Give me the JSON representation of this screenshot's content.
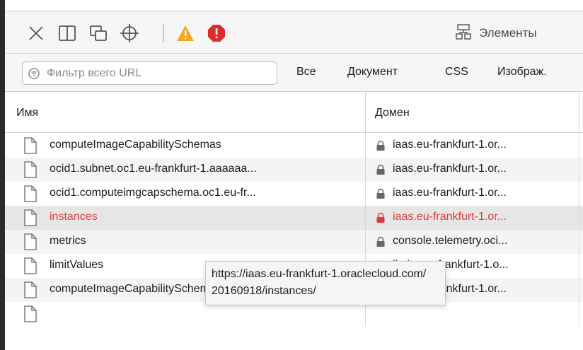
{
  "toolbar": {
    "icons": [
      "close-icon",
      "dock-split-icon",
      "undock-window-icon",
      "element-picker-icon",
      "warning-icon",
      "error-icon"
    ],
    "elements_tab_label": "Элементы"
  },
  "filter": {
    "placeholder": "Фильтр всего URL"
  },
  "type_filters": [
    "Все",
    "Документ",
    "CSS",
    "Изображ."
  ],
  "table": {
    "columns": [
      "Имя",
      "Домен"
    ],
    "rows": [
      {
        "name": "computeImageCapabilitySchemas",
        "domain": "iaas.eu-frankfurt-1.or...",
        "error": false
      },
      {
        "name": "ocid1.subnet.oc1.eu-frankfurt-1.aaaaaa...",
        "domain": "iaas.eu-frankfurt-1.or...",
        "error": false
      },
      {
        "name": "ocid1.computeimgcapschema.oc1.eu-fr...",
        "domain": "iaas.eu-frankfurt-1.or...",
        "error": false
      },
      {
        "name": "instances",
        "domain": "iaas.eu-frankfurt-1.or...",
        "error": true
      },
      {
        "name": "metrics",
        "domain": "console.telemetry.oci...",
        "error": false
      },
      {
        "name": "limitValues",
        "domain": "limits.eu-frankfurt-1.o...",
        "error": false
      },
      {
        "name": "computeImageCapabilitySchemas",
        "domain": "iaas.eu-frankfurt-1.or...",
        "error": false
      },
      {
        "name": "",
        "domain": "",
        "error": false
      }
    ]
  },
  "tooltip": {
    "line1": "https://iaas.eu-frankfurt-1.oraclecloud.com/",
    "line2": "20160918/instances/"
  },
  "colors": {
    "error": "#e23b3b",
    "warning": "#f5a623",
    "toolbar_bg": "#f6f6f6"
  }
}
